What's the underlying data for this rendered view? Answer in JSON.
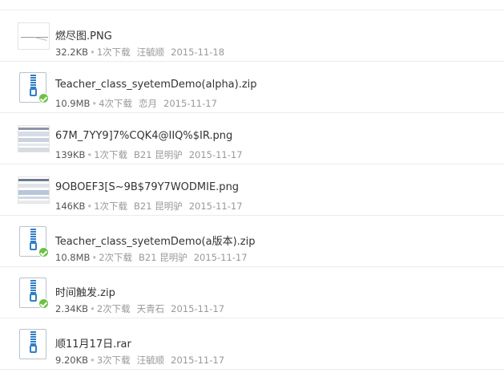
{
  "files": [
    {
      "name": "燃尽图.PNG",
      "size": "32.2KB",
      "downloads": "1次下载",
      "uploader": "汪毓顺",
      "date": "2015-11-18",
      "type": "image",
      "thumb": "burndown-chart"
    },
    {
      "name": "Teacher_class_syetemDemo(alpha).zip",
      "size": "10.9MB",
      "downloads": "4次下载",
      "uploader": "恋月",
      "date": "2015-11-17",
      "type": "zip"
    },
    {
      "name": "67M_7YY9]7%CQK4@IIQ%$IR.png",
      "size": "139KB",
      "downloads": "1次下载",
      "uploader": "B21 昆明驴",
      "date": "2015-11-17",
      "type": "image",
      "thumb": "screenshot"
    },
    {
      "name": "9OBOEF3[S~9B$79Y7WODMIE.png",
      "size": "146KB",
      "downloads": "1次下载",
      "uploader": "B21 昆明驴",
      "date": "2015-11-17",
      "type": "image",
      "thumb": "screenshot"
    },
    {
      "name": "Teacher_class_syetemDemo(a版本).zip",
      "size": "10.8MB",
      "downloads": "2次下载",
      "uploader": "B21 昆明驴",
      "date": "2015-11-17",
      "type": "zip"
    },
    {
      "name": "时间触发.zip",
      "size": "2.34KB",
      "downloads": "2次下载",
      "uploader": "天青石",
      "date": "2015-11-17",
      "type": "zip"
    },
    {
      "name": "顺11月17日.rar",
      "size": "9.20KB",
      "downloads": "3次下载",
      "uploader": "汪毓顺",
      "date": "2015-11-17",
      "type": "zip"
    }
  ],
  "separator": "•",
  "colors": {
    "zip_blue": "#2f7fc6",
    "ok_green": "#6cc247",
    "divider": "#ececec"
  }
}
